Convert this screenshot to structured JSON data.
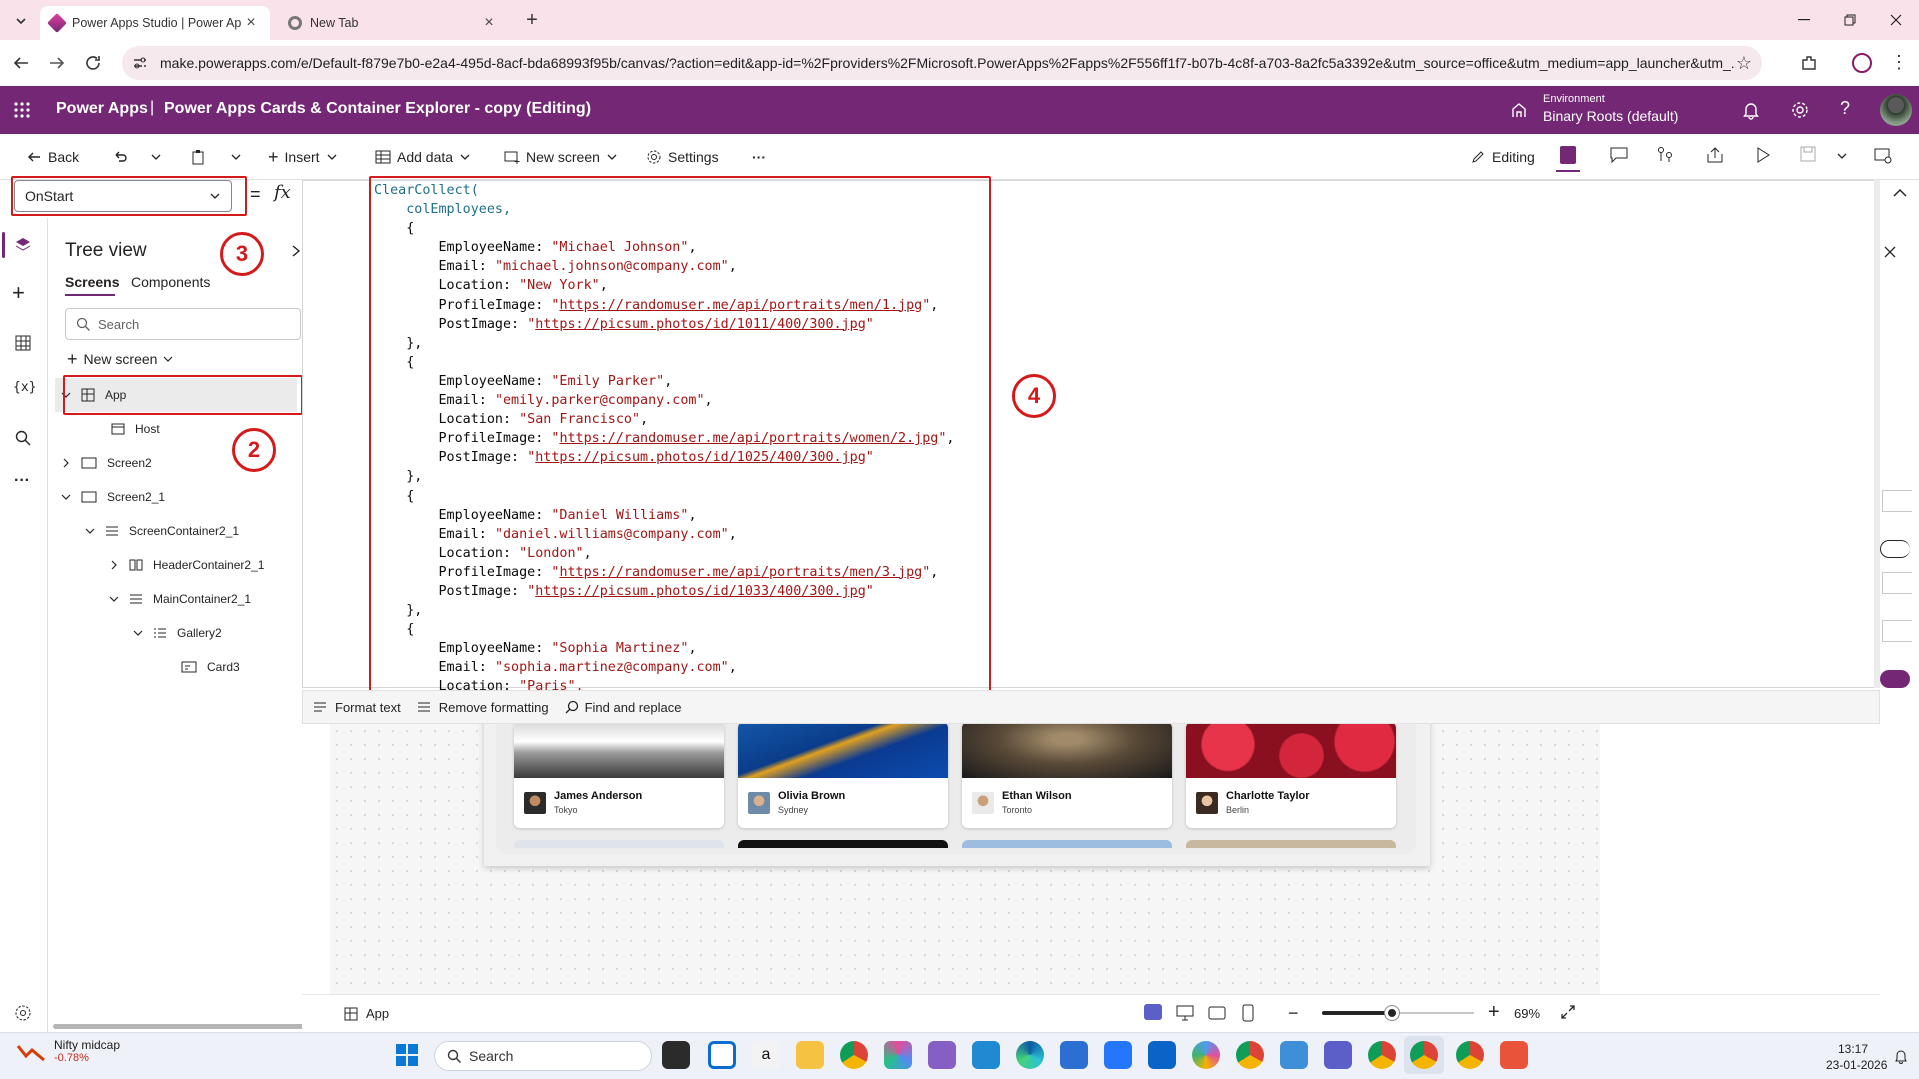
{
  "browser": {
    "tabs": [
      {
        "label": "Power Apps Studio | Power Apps",
        "active": true
      },
      {
        "label": "New Tab",
        "active": false
      }
    ],
    "url": "make.powerapps.com/e/Default-f879e7b0-e2a4-495d-8acf-bda68993f95b/canvas/?action=edit&app-id=%2Fproviders%2FMicrosoft.PowerApps%2Fapps%2F556ff1f7-b07b-4c8f-a703-8a2fc5a3392e&utm_source=office&utm_medium=app_launcher&utm_..."
  },
  "header": {
    "app_name": "Power Apps",
    "separator": "|",
    "title": "Power Apps Cards & Container Explorer - copy (Editing)",
    "environment_label": "Environment",
    "environment_value": "Binary Roots (default)",
    "accent": "#742774"
  },
  "commandbar": {
    "back": "Back",
    "insert": "Insert",
    "add_data": "Add data",
    "new_screen": "New screen",
    "settings": "Settings",
    "more": "···",
    "editing": "Editing"
  },
  "formula": {
    "property": "OnStart",
    "equals": "=",
    "fx": "fx"
  },
  "tree": {
    "title": "Tree view",
    "tabs": [
      "Screens",
      "Components"
    ],
    "search_placeholder": "Search",
    "new_screen": "New screen",
    "items": [
      {
        "label": "App"
      },
      {
        "label": "Host"
      },
      {
        "label": "Screen2"
      },
      {
        "label": "Screen2_1"
      },
      {
        "label": "ScreenContainer2_1"
      },
      {
        "label": "HeaderContainer2_1"
      },
      {
        "label": "MainContainer2_1"
      },
      {
        "label": "Gallery2"
      },
      {
        "label": "Card3"
      }
    ]
  },
  "annotations": [
    "2",
    "3",
    "4"
  ],
  "code": {
    "fn": "ClearCollect(",
    "collection": "colEmployees,",
    "records": [
      {
        "name": "\"Michael Johnson\"",
        "email": "\"michael.johnson@company.com\"",
        "location": "\"New York\"",
        "profile": "https://randomuser.me/api/portraits/men/1.jpg",
        "post": "https://picsum.photos/id/1011/400/300.jpg"
      },
      {
        "name": "\"Emily Parker\"",
        "email": "\"emily.parker@company.com\"",
        "location": "\"San Francisco\"",
        "profile": "https://randomuser.me/api/portraits/women/2.jpg",
        "post": "https://picsum.photos/id/1025/400/300.jpg"
      },
      {
        "name": "\"Daniel Williams\"",
        "email": "\"daniel.williams@company.com\"",
        "location": "\"London\"",
        "profile": "https://randomuser.me/api/portraits/men/3.jpg",
        "post": "https://picsum.photos/id/1033/400/300.jpg"
      },
      {
        "name": "\"Sophia Martinez\"",
        "email": "\"sophia.martinez@company.com\"",
        "location": "\"Paris\","
      }
    ],
    "keys": {
      "name": "EmployeeName:",
      "email": "Email:",
      "location": "Location:",
      "profile": "ProfileImage:",
      "post": "PostImage:"
    }
  },
  "editor_toolbar": {
    "format": "Format text",
    "remove": "Remove formatting",
    "find": "Find and replace"
  },
  "gallery_cards": [
    {
      "name": "James Anderson",
      "location": "Tokyo"
    },
    {
      "name": "Olivia Brown",
      "location": "Sydney"
    },
    {
      "name": "Ethan Wilson",
      "location": "Toronto"
    },
    {
      "name": "Charlotte Taylor",
      "location": "Berlin"
    }
  ],
  "statusbar": {
    "screen": "App",
    "zoom": "69",
    "zoom_suffix": "%",
    "zoom_level": 0.69
  },
  "taskbar": {
    "widget_title": "Nifty midcap",
    "widget_value": "-0.78%",
    "search": "Search",
    "time": "13:17",
    "date": "23-01-2026"
  }
}
